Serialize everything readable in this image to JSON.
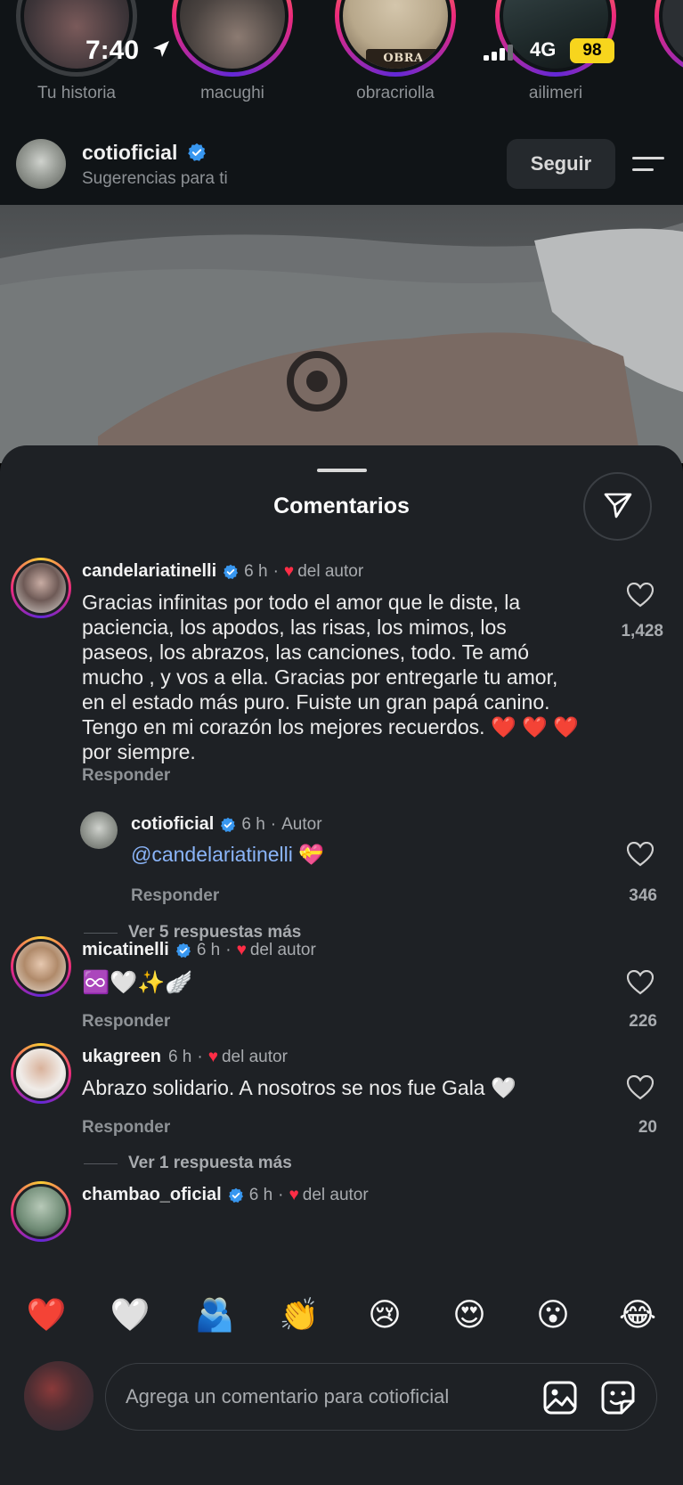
{
  "status": {
    "time": "7:40",
    "network": "4G",
    "battery": "98"
  },
  "stories": [
    {
      "name": "Tu historia",
      "seen": true
    },
    {
      "name": "macughi",
      "seen": false
    },
    {
      "name": "obracriolla",
      "seen": false,
      "tag": "OBRA CRIOLLA"
    },
    {
      "name": "ailimeri",
      "seen": false
    }
  ],
  "post": {
    "username": "cotioficial",
    "subtitle": "Sugerencias para ti",
    "follow_label": "Seguir"
  },
  "sheet": {
    "title": "Comentarios"
  },
  "comments": [
    {
      "username": "candelariatinelli",
      "time": "6 h",
      "separator": "·",
      "author_like": "del autor",
      "text": "Gracias infinitas por todo el amor que le diste, la paciencia, los apodos, las risas, los mimos, los paseos, los abrazos, las canciones, todo. Te amó mucho , y vos a ella. Gracias por entregarle tu amor, en el estado más puro. Fuiste un gran papá canino. Tengo en mi corazón los mejores recuerdos. ❤️ ❤️ ❤️  por siempre.",
      "reply_label": "Responder",
      "likes": "1,428"
    },
    {
      "username": "cotioficial",
      "time": "6 h",
      "separator": "·",
      "author_tag": "Autor",
      "mention": "@candelariatinelli",
      "emoji": "💝",
      "reply_label": "Responder",
      "likes": "346",
      "more_replies": "Ver 5 respuestas más"
    },
    {
      "username": "micatinelli",
      "time": "6 h",
      "separator": "·",
      "author_like": "del autor",
      "text": "♾️🤍✨🪽",
      "reply_label": "Responder",
      "likes": "226"
    },
    {
      "username": "ukagreen",
      "time": "6 h",
      "separator": "·",
      "author_like": "del autor",
      "text": "Abrazo solidario. A nosotros se nos fue Gala 🤍",
      "reply_label": "Responder",
      "likes": "20",
      "more_replies": "Ver 1 respuesta más"
    },
    {
      "username": "chambao_oficial",
      "time": "6 h",
      "separator": "·",
      "author_like": "del autor"
    }
  ],
  "emoji_bar": [
    "❤️",
    "🤍",
    "🫂",
    "👏",
    "😢",
    "😍",
    "😮",
    "😂"
  ],
  "composer": {
    "placeholder": "Agrega un comentario para cotioficial"
  },
  "colors": {
    "sheet_bg": "#1e2125",
    "mention": "#8ab4f8",
    "verified": "#3897f0",
    "heart": "#ff2d46",
    "battery": "#f7d51d"
  }
}
